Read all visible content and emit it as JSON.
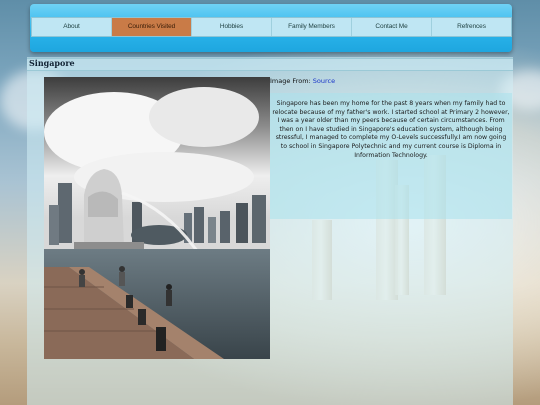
{
  "nav": {
    "items": [
      {
        "label": "About"
      },
      {
        "label": "Countries Visited"
      },
      {
        "label": "Hobbies"
      },
      {
        "label": "Family Members"
      },
      {
        "label": "Contact Me"
      },
      {
        "label": "Refrences"
      }
    ],
    "active_index": 1
  },
  "page": {
    "title": "Singapore"
  },
  "image": {
    "caption_prefix": "Image From:",
    "caption_link": "Source"
  },
  "description": "Singapore has been my home for the past 8 years when my family had to relocate because of my father's work. I started school at Primary 2 however, I was a year older than my peers because of certain circumstances. From then on I have studied in Singapore's education system, although being stressful, I managed to complete my O-Levels successfully.I am now going to school in Singapore Polytechnic and my current course is Diploma in Information Technology.",
  "colors": {
    "nav_gradient": "#2ab3ea",
    "nav_active": "#c97b47",
    "link": "#1a35c8"
  }
}
